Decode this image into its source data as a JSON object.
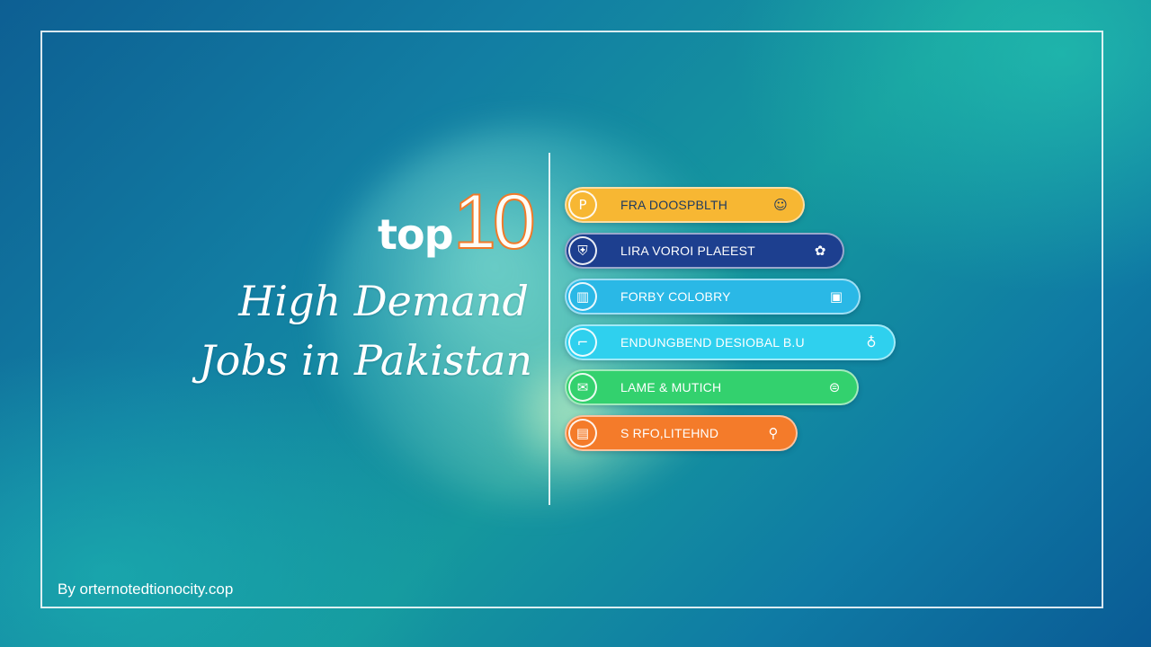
{
  "title": {
    "top_word": "top",
    "top_number": "10",
    "line1": "High Demand",
    "line2": "Jobs in Pakistan"
  },
  "jobs": [
    {
      "label": "FRA DOOSPBLTH",
      "badge_icon": "P",
      "end_icon": "☺",
      "icon_name": "location-pin-icon",
      "end_icon_name": "smile-icon",
      "color": "#f7b733",
      "text_color": "#1e3a5f"
    },
    {
      "label": "LIRA VOROI PLAEEST",
      "badge_icon": "⛨",
      "end_icon": "✿",
      "icon_name": "shield-icon",
      "end_icon_name": "gear-icon",
      "color": "#1d3f8f",
      "text_color": "#ffffff"
    },
    {
      "label": "FORBY COLOBRY",
      "badge_icon": "▥",
      "end_icon": "▣",
      "icon_name": "tools-icon",
      "end_icon_name": "document-icon",
      "color": "#2ab8e6",
      "text_color": "#ffffff"
    },
    {
      "label": "ENDUNGBEND DESIOBAL B.U",
      "badge_icon": "⌐",
      "end_icon": "♁",
      "icon_name": "hammer-icon",
      "end_icon_name": "globe-icon",
      "color": "#2fd0ee",
      "text_color": "#ffffff"
    },
    {
      "label": "LAME & MUTICH",
      "badge_icon": "✉",
      "end_icon": "⊜",
      "icon_name": "envelope-icon",
      "end_icon_name": "chat-icon",
      "color": "#33d16e",
      "text_color": "#ffffff"
    },
    {
      "label": "S RFO,LITEHND",
      "badge_icon": "▤",
      "end_icon": "⚲",
      "icon_name": "book-icon",
      "end_icon_name": "search-icon",
      "color": "#f47b2a",
      "text_color": "#ffffff"
    }
  ],
  "credit": "By orternotedtionocity.cop"
}
